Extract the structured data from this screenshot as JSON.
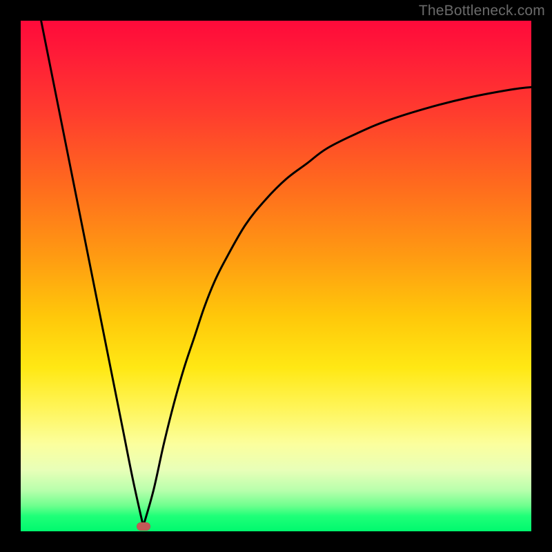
{
  "watermark": "TheBottleneck.com",
  "chart_data": {
    "type": "line",
    "title": "",
    "xlabel": "",
    "ylabel": "",
    "xlim": [
      0,
      100
    ],
    "ylim": [
      0,
      100
    ],
    "grid": false,
    "legend": false,
    "annotations": [],
    "marker": {
      "x": 24,
      "y": 1,
      "color": "#c25a57"
    },
    "series": [
      {
        "name": "bottleneck-curve",
        "segment": "left",
        "x": [
          4,
          6,
          8,
          10,
          12,
          14,
          16,
          18,
          20,
          22,
          24
        ],
        "y": [
          100,
          90,
          80,
          70,
          60,
          50,
          40,
          30,
          20,
          10,
          1
        ]
      },
      {
        "name": "bottleneck-curve",
        "segment": "right",
        "x": [
          24,
          26,
          28,
          30,
          32,
          34,
          36,
          38,
          40,
          44,
          48,
          52,
          56,
          60,
          66,
          72,
          80,
          88,
          96,
          100
        ],
        "y": [
          1,
          8,
          17,
          25,
          32,
          38,
          44,
          49,
          53,
          60,
          65,
          69,
          72,
          75,
          78,
          80.5,
          83,
          85,
          86.5,
          87
        ]
      }
    ],
    "background_gradient": {
      "direction": "vertical",
      "stops": [
        {
          "pos": 0.0,
          "color": "#ff0a3a"
        },
        {
          "pos": 0.46,
          "color": "#ff9a12"
        },
        {
          "pos": 0.76,
          "color": "#fff55a"
        },
        {
          "pos": 1.0,
          "color": "#00f96e"
        }
      ]
    }
  }
}
